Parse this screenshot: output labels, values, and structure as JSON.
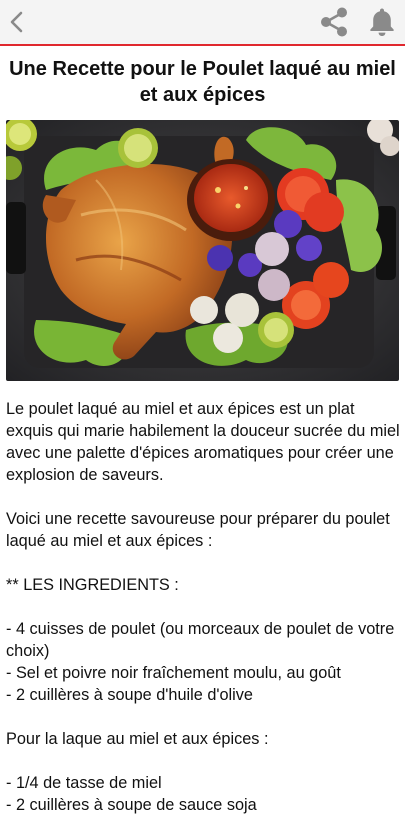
{
  "app_bar": {
    "back_icon": "chevron-left-icon",
    "share_icon": "share-icon",
    "notifications_icon": "bell-icon",
    "accent_color": "#e0282e"
  },
  "recipe": {
    "title": "Une Recette pour le Poulet laqué au miel et aux épices",
    "image_alt": "Poulet laqué grillé avec sauce épicée, tomates, oignons et salade",
    "intro": "Le poulet laqué au miel et aux épices est un plat exquis qui marie habilement la douceur sucrée du miel avec une palette d'épices aromatiques pour créer une explosion de saveurs.",
    "lead": "Voici une recette savoureuse pour préparer du poulet laqué au miel et aux épices :",
    "ingredients_heading": "** LES INGREDIENTS :",
    "ingredients": [
      "- 4 cuisses de poulet (ou morceaux de poulet de votre choix)",
      "- Sel et poivre noir fraîchement moulu, au goût",
      "- 2 cuillères à soupe d'huile d'olive"
    ],
    "glaze_heading": "Pour la laque au miel et aux épices :",
    "glaze": [
      "- 1/4 de tasse de miel",
      "- 2 cuillères à soupe de sauce soja"
    ]
  }
}
